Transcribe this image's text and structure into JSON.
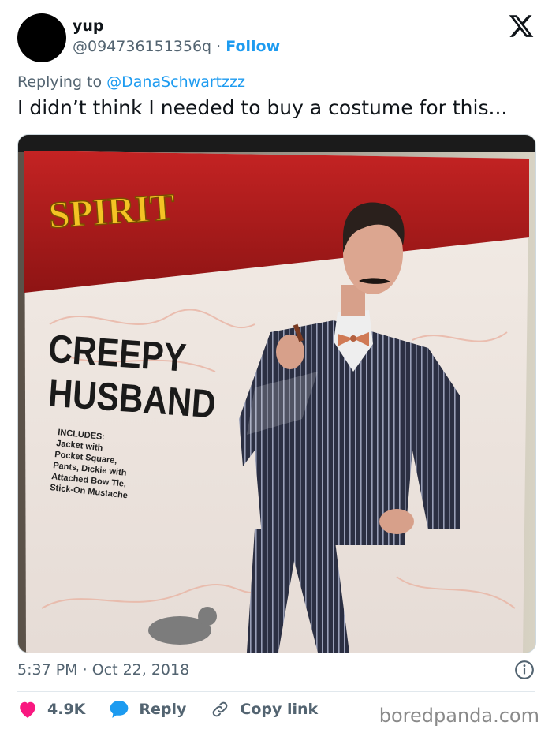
{
  "author": {
    "name": "yup",
    "handle": "@094736151356q",
    "separator": " · ",
    "follow_label": "Follow"
  },
  "platform_icon": "x-logo-icon",
  "reply_context": {
    "prefix": "Replying to ",
    "mention": "@DanaSchwartzzz"
  },
  "tweet_text": "I didn’t think I needed to buy a costume for this...",
  "media": {
    "brand_logo_text": "SPIRIT",
    "product_title_line1": "CREEPY",
    "product_title_line2": "HUSBAND",
    "includes_lines": [
      "INCLUDES:",
      "Jacket with",
      "Pocket Square,",
      "Pants, Dickie with",
      "Attached Bow Tie,",
      "Stick-On Mustache"
    ]
  },
  "timestamp": {
    "time": "5:37 PM",
    "separator": " · ",
    "date": "Oct 22, 2018"
  },
  "actions": {
    "like_count": "4.9K",
    "reply_label": "Reply",
    "copy_link_label": "Copy link"
  },
  "watermark": "boredpanda.com",
  "colors": {
    "accent": "#1d9bf0",
    "like": "#f91880",
    "muted": "#536471"
  }
}
